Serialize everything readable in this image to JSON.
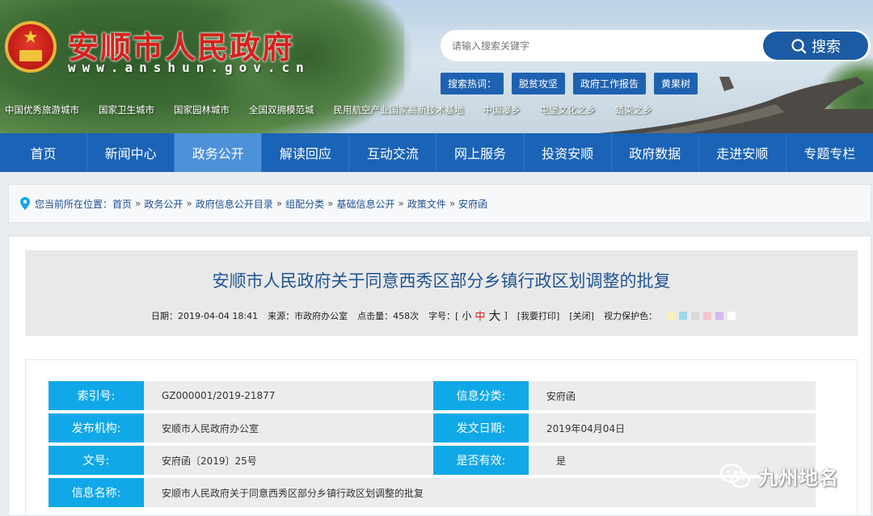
{
  "header": {
    "site_title": "安顺市人民政府",
    "site_url": "www.anshun.gov.cn",
    "search": {
      "placeholder": "请输入搜索关键字",
      "button_label": "搜索"
    },
    "hot_words": [
      "搜索热词：",
      "脱贫攻坚",
      "政府工作报告",
      "黄果树"
    ],
    "honors": [
      "中国优秀旅游城市",
      "国家卫生城市",
      "国家园林城市",
      "全国双拥模范城",
      "民用航空产业国家高新技术基地",
      "中国瀑乡",
      "屯堡文化之乡",
      "蜡染之乡"
    ]
  },
  "nav": {
    "items": [
      "首页",
      "新闻中心",
      "政务公开",
      "解读回应",
      "互动交流",
      "网上服务",
      "投资安顺",
      "政府数据",
      "走进安顺",
      "专题专栏"
    ],
    "active_index": 2
  },
  "breadcrumb": {
    "prefix": "您当前所在位置：",
    "items": [
      "首页",
      "政务公开",
      "政府信息公开目录",
      "组配分类",
      "基础信息公开",
      "政策文件",
      "安府函"
    ],
    "separator": "»"
  },
  "article": {
    "title": "安顺市人民政府关于同意西秀区部分乡镇行政区划调整的批复",
    "meta": {
      "date": "日期：2019-04-04 18:41",
      "source": "来源：市政府办公室",
      "clicks": "点击量：458次",
      "font_size_label": "字号：[",
      "font_small": "小",
      "font_medium": "中",
      "font_large": "大",
      "font_size_end": "]",
      "print": "[我要打印]",
      "close": "[关闭]",
      "eye_care_label": "视力保护色：",
      "eye_care_colors": [
        "#f7f1b8",
        "#9fd8ef",
        "#d9d9d9",
        "#f5c3d2",
        "#d4b8ef",
        "#ffffff"
      ]
    },
    "info": {
      "index_no": {
        "label": "索引号:",
        "value": "GZ000001/2019-21877"
      },
      "category": {
        "label": "信息分类:",
        "value": "安府函"
      },
      "issuer": {
        "label": "发布机构:",
        "value": "安顺市人民政府办公室"
      },
      "issue_date": {
        "label": "发文日期:",
        "value": "2019年04月04日"
      },
      "doc_no": {
        "label": "文号:",
        "value": "安府函〔2019〕25号"
      },
      "valid": {
        "label": "是否有效:",
        "value": "是"
      },
      "info_name": {
        "label": "信息名称:",
        "value": "安顺市人民政府关于同意西秀区部分乡镇行政区划调整的批复"
      }
    }
  },
  "watermark": {
    "text": "九州地名"
  }
}
